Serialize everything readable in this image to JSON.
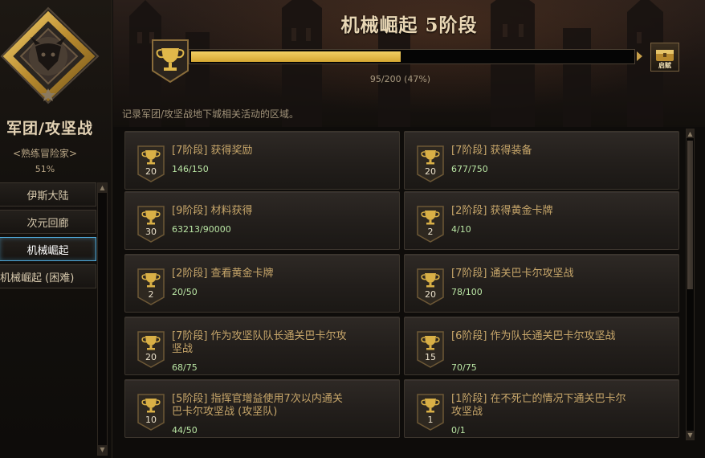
{
  "sidebar": {
    "category_title": "军团/攻坚战",
    "rank_label": "<熟练冒险家>",
    "rank_percent": "51%",
    "nav_items": [
      {
        "label": "伊斯大陆"
      },
      {
        "label": "次元回廊"
      },
      {
        "label": "机械崛起",
        "active": true
      },
      {
        "label": "机械崛起 (困难)"
      }
    ]
  },
  "header": {
    "title": "机械崛起 5阶段",
    "progress_text": "95/200 (47%)",
    "progress_fraction": 0.475,
    "reward_label": "启赋",
    "description": "记录军团/攻坚战地下城相关活动的区域。"
  },
  "achievements": [
    {
      "title": "[7阶段] 获得奖励",
      "progress": "146/150",
      "points": "20"
    },
    {
      "title": "[7阶段] 获得装备",
      "progress": "677/750",
      "points": "20"
    },
    {
      "title": "[9阶段] 材料获得",
      "progress": "63213/90000",
      "points": "30"
    },
    {
      "title": "[2阶段] 获得黄金卡牌",
      "progress": "4/10",
      "points": "2"
    },
    {
      "title": "[2阶段] 查看黄金卡牌",
      "progress": "20/50",
      "points": "2"
    },
    {
      "title": "[7阶段] 通关巴卡尔攻坚战",
      "progress": "78/100",
      "points": "20"
    },
    {
      "title": "[7阶段] 作为攻坚队队长通关巴卡尔攻坚战",
      "progress": "68/75",
      "points": "20"
    },
    {
      "title": "[6阶段] 作为队长通关巴卡尔攻坚战",
      "progress": "70/75",
      "points": "15"
    },
    {
      "title": "[5阶段] 指挥官增益使用7次以内通关巴卡尔攻坚战 (攻坚队)",
      "progress": "44/50",
      "points": "10"
    },
    {
      "title": "[1阶段] 在不死亡的情况下通关巴卡尔攻坚战",
      "progress": "0/1",
      "points": "1"
    }
  ],
  "colors": {
    "accent_gold": "#d6a732",
    "progress_green": "#b9e5a4",
    "active_border": "#4fa8d8"
  },
  "icons": {
    "emblem": "guild-crest-icon",
    "trophy": "trophy-icon",
    "reward": "treasure-chest-icon"
  }
}
